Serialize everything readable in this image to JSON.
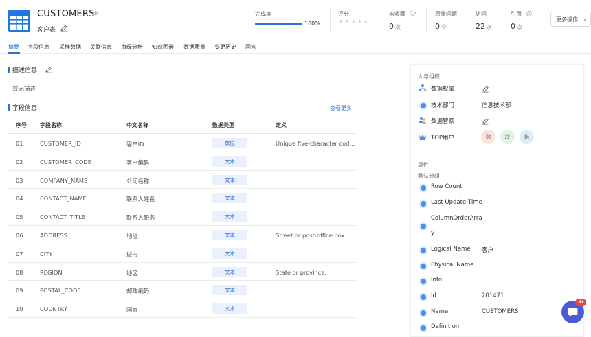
{
  "header": {
    "title": "CUSTOMERS",
    "title_suffix": "❄",
    "subtitle": "客户表",
    "metrics": {
      "completeness": {
        "label": "完成度",
        "percent": 100,
        "display": "100%"
      },
      "rating": {
        "label": "评分",
        "stars": "★★★★★"
      },
      "favorites": {
        "label": "未收藏",
        "value": "0",
        "unit": "次"
      },
      "quality_issues": {
        "label": "质量问题",
        "value": "0",
        "unit": "个"
      },
      "visits": {
        "label": "访问",
        "value": "22",
        "unit": "次"
      },
      "references": {
        "label": "引用",
        "value": "0",
        "unit": "次"
      }
    },
    "more_actions": "更多操作",
    "more_caret": "⌄"
  },
  "tabs": [
    "摘要",
    "字段信息",
    "采样数据",
    "关联信息",
    "血缘分析",
    "知识图谱",
    "数据质量",
    "变更历史",
    "问答"
  ],
  "description": {
    "heading": "描述信息",
    "empty_text": "暂无描述"
  },
  "fields": {
    "heading": "字段信息",
    "see_more": "查看更多",
    "columns": {
      "no": "序号",
      "name": "字段名称",
      "cn_name": "中文名称",
      "type": "数据类型",
      "definition": "定义"
    },
    "rows": [
      {
        "no": "01",
        "name": "CUSTOMER_ID",
        "cn_name": "客户ID",
        "type": "数值",
        "definition": "Unique five-character cod..."
      },
      {
        "no": "02",
        "name": "CUSTOMER_CODE",
        "cn_name": "客户编码",
        "type": "文本",
        "definition": ""
      },
      {
        "no": "03",
        "name": "COMPANY_NAME",
        "cn_name": "公司名称",
        "type": "文本",
        "definition": ""
      },
      {
        "no": "04",
        "name": "CONTACT_NAME",
        "cn_name": "联系人姓名",
        "type": "文本",
        "definition": ""
      },
      {
        "no": "05",
        "name": "CONTACT_TITLE",
        "cn_name": "联系人职务",
        "type": "文本",
        "definition": ""
      },
      {
        "no": "06",
        "name": "ADDRESS",
        "cn_name": "地址",
        "type": "文本",
        "definition": "Street or post-office box."
      },
      {
        "no": "07",
        "name": "CITY",
        "cn_name": "城市",
        "type": "文本",
        "definition": ""
      },
      {
        "no": "08",
        "name": "REGION",
        "cn_name": "地区",
        "type": "文本",
        "definition": "State or province."
      },
      {
        "no": "09",
        "name": "POSTAL_CODE",
        "cn_name": "邮政编码",
        "type": "文本",
        "definition": ""
      },
      {
        "no": "10",
        "name": "COUNTRY",
        "cn_name": "国家",
        "type": "文本",
        "definition": ""
      }
    ]
  },
  "people": {
    "heading": "人与组织",
    "items": [
      {
        "label": "数据权属",
        "value": "",
        "icon": "org-icon"
      },
      {
        "label": "技术部门",
        "value": "信息技术部",
        "icon": "dot-icon"
      },
      {
        "label": "数据管家",
        "value": "",
        "icon": "users-icon"
      },
      {
        "label": "TOP用户",
        "value": "",
        "icon": "crown-icon"
      }
    ],
    "top_users": [
      {
        "text": "数",
        "color": "#fbe3dc"
      },
      {
        "text": "冷",
        "color": "#dff3e2"
      },
      {
        "text": "朱",
        "color": "#dcefF7"
      }
    ]
  },
  "attributes": {
    "heading": "属性",
    "group": "默认分组",
    "items": [
      {
        "label": "Row Count",
        "value": ""
      },
      {
        "label": "Last Update Time",
        "value": ""
      },
      {
        "label": "ColumnOrderArra",
        "label2": "y",
        "value": ""
      },
      {
        "label": "Logical Name",
        "value": "客户"
      },
      {
        "label": "Physical Name",
        "value": ""
      },
      {
        "label": "Info",
        "value": ""
      },
      {
        "label": "Id",
        "value": "201471"
      },
      {
        "label": "Name",
        "value": "CUSTOMERS"
      },
      {
        "label": "Definition",
        "value": ""
      }
    ]
  },
  "ai_assistant": {
    "badge": "AI"
  },
  "colors": {
    "accent": "#2f6fd8",
    "badge_bg": "#eaf0fc",
    "fab": "#4a5bd4"
  }
}
